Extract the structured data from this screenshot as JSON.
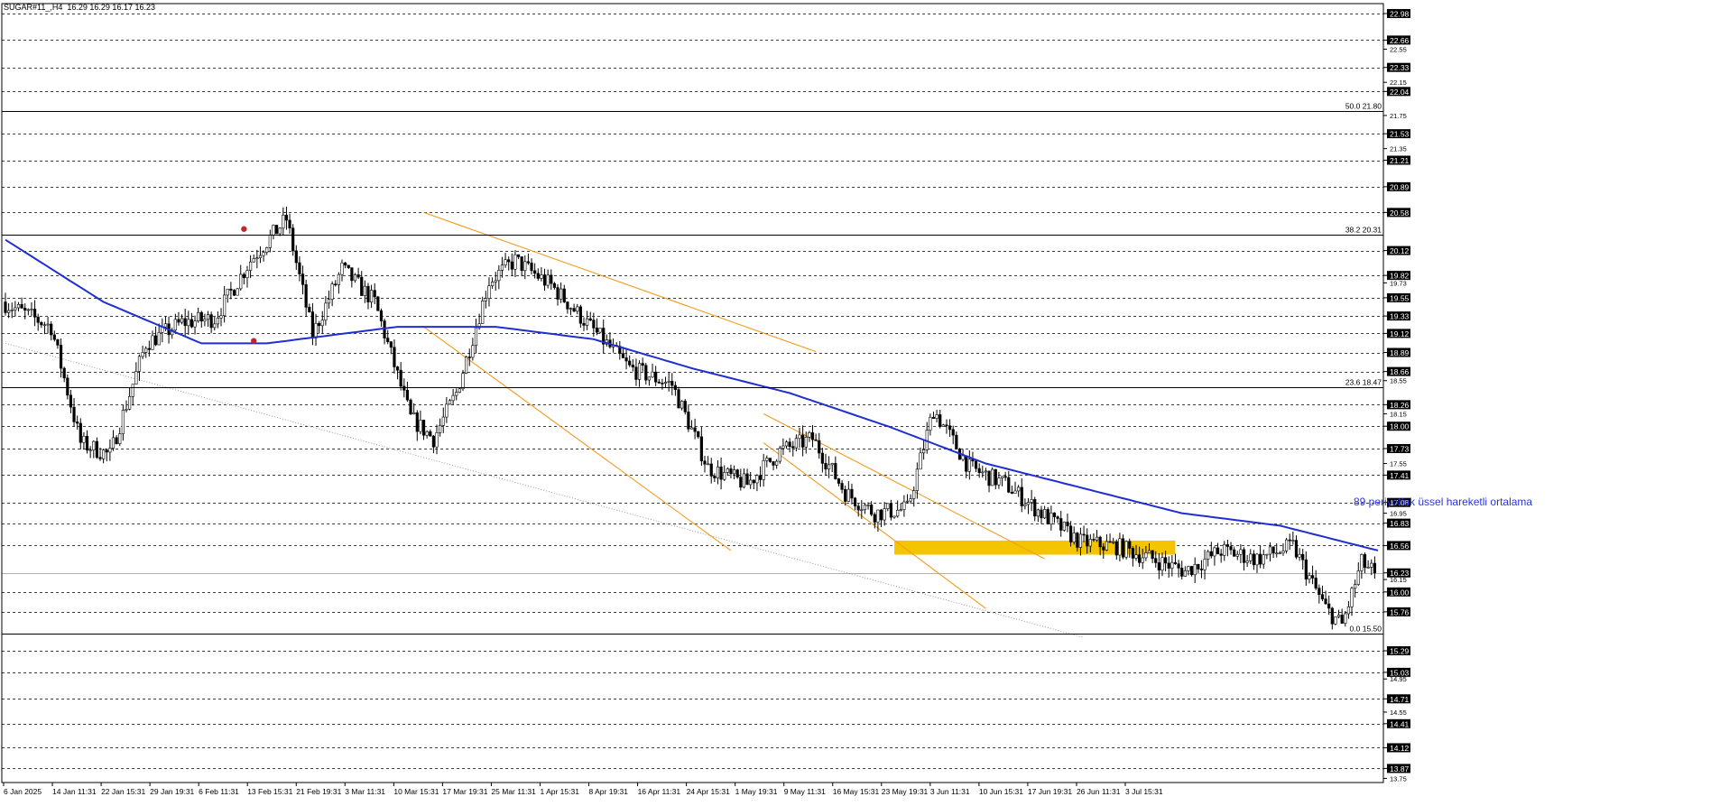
{
  "header": {
    "symbol": "SUGAR#11_,H4",
    "ohlc": "16.29 16.29 16.17 16.23"
  },
  "colors": {
    "background": "#ffffff",
    "grid": "#000000",
    "candle_up_fill": "#ffffff",
    "candle_down_fill": "#000000",
    "ema": "#1f2fd0",
    "channel": "#f59a1e",
    "zone": "#f5c400",
    "annotation": "#2b35d8",
    "marker": "#c0262d",
    "trend_dotted": "#9a9a9a"
  },
  "chart_data": {
    "type": "candlestick",
    "y_axis_price_labels": [
      "22.98",
      "22.66",
      "22.55",
      "22.33",
      "22.15",
      "22.04",
      "21.75",
      "21.53",
      "21.35",
      "21.21",
      "20.89",
      "20.58",
      "20.12",
      "19.82",
      "19.73",
      "19.55",
      "19.33",
      "19.12",
      "18.89",
      "18.66",
      "18.55",
      "18.26",
      "18.15",
      "18.00",
      "17.73",
      "17.55",
      "17.41",
      "17.08",
      "16.95",
      "16.83",
      "16.56",
      "16.23",
      "16.15",
      "16.00",
      "15.76",
      "15.29",
      "15.03",
      "14.95",
      "14.71",
      "14.55",
      "14.41",
      "14.12",
      "13.87",
      "13.75"
    ],
    "highlighted_price_labels": [
      "22.98",
      "22.66",
      "22.33",
      "22.04",
      "21.53",
      "21.21",
      "20.89",
      "20.58",
      "20.12",
      "19.82",
      "19.55",
      "19.33",
      "19.12",
      "18.89",
      "18.66",
      "18.26",
      "18.00",
      "17.73",
      "17.41",
      "17.08",
      "16.83",
      "16.56",
      "16.23",
      "16.00",
      "15.76",
      "15.29",
      "15.03",
      "14.71",
      "14.41",
      "14.12",
      "13.87"
    ],
    "current_price": 16.23,
    "y_range": [
      13.7,
      23.1
    ],
    "x_axis_labels": [
      "6 Jan 2025",
      "14 Jan 11:31",
      "22 Jan 15:31",
      "29 Jan 19:31",
      "6 Feb 11:31",
      "13 Feb 15:31",
      "21 Feb 19:31",
      "3 Mar 11:31",
      "10 Mar 15:31",
      "17 Mar 19:31",
      "25 Mar 11:31",
      "1 Apr 15:31",
      "8 Apr 19:31",
      "16 Apr 11:31",
      "24 Apr 15:31",
      "1 May 19:31",
      "9 May 11:31",
      "16 May 15:31",
      "23 May 19:31",
      "3 Jun 11:31",
      "10 Jun 15:31",
      "17 Jun 19:31",
      "26 Jun 11:31",
      "3 Jul 15:31"
    ],
    "fibonacci_levels": [
      {
        "label": "50.0 21.80",
        "price": 21.8
      },
      {
        "label": "38.2 20.31",
        "price": 20.31
      },
      {
        "label": "23.6 18.47",
        "price": 18.47
      },
      {
        "label": "0.0 15.50",
        "price": 15.5
      }
    ],
    "price_path": [
      [
        0,
        19.5
      ],
      [
        15,
        19.2
      ],
      [
        24,
        17.8
      ],
      [
        33,
        17.65
      ],
      [
        44,
        19.0
      ],
      [
        55,
        19.25
      ],
      [
        65,
        19.3
      ],
      [
        76,
        20.0
      ],
      [
        87,
        20.5
      ],
      [
        95,
        19.1
      ],
      [
        104,
        19.9
      ],
      [
        114,
        19.5
      ],
      [
        125,
        18.1
      ],
      [
        132,
        17.85
      ],
      [
        139,
        18.4
      ],
      [
        149,
        19.75
      ],
      [
        157,
        20.0
      ],
      [
        168,
        19.7
      ],
      [
        180,
        19.2
      ],
      [
        192,
        18.7
      ],
      [
        205,
        18.5
      ],
      [
        216,
        17.5
      ],
      [
        228,
        17.3
      ],
      [
        238,
        17.7
      ],
      [
        248,
        17.85
      ],
      [
        258,
        17.2
      ],
      [
        267,
        16.95
      ],
      [
        277,
        17.0
      ],
      [
        285,
        18.2
      ],
      [
        296,
        17.5
      ],
      [
        307,
        17.3
      ],
      [
        318,
        16.95
      ],
      [
        330,
        16.6
      ],
      [
        341,
        16.55
      ],
      [
        352,
        16.4
      ],
      [
        362,
        16.25
      ],
      [
        373,
        16.5
      ],
      [
        384,
        16.4
      ],
      [
        395,
        16.55
      ],
      [
        405,
        15.8
      ],
      [
        410,
        15.6
      ],
      [
        416,
        16.35
      ],
      [
        420,
        16.23
      ]
    ],
    "ema89_path": [
      [
        0,
        20.25
      ],
      [
        30,
        19.5
      ],
      [
        60,
        19.0
      ],
      [
        80,
        19.0
      ],
      [
        100,
        19.1
      ],
      [
        120,
        19.2
      ],
      [
        150,
        19.2
      ],
      [
        180,
        19.05
      ],
      [
        210,
        18.7
      ],
      [
        240,
        18.4
      ],
      [
        270,
        18.0
      ],
      [
        300,
        17.55
      ],
      [
        330,
        17.25
      ],
      [
        360,
        16.95
      ],
      [
        390,
        16.8
      ],
      [
        405,
        16.65
      ],
      [
        420,
        16.5
      ]
    ],
    "candle_count": 420,
    "markers": [
      {
        "bar": 73,
        "price": 20.38
      },
      {
        "bar": 76,
        "price": 19.03
      }
    ],
    "descending_channels": [
      {
        "upper": [
          [
            128,
            20.58
          ],
          [
            248,
            18.9
          ]
        ],
        "lower": [
          [
            128,
            19.2
          ],
          [
            222,
            16.5
          ]
        ]
      },
      {
        "upper": [
          [
            232,
            18.15
          ],
          [
            318,
            16.4
          ]
        ],
        "lower": [
          [
            232,
            17.8
          ],
          [
            300,
            15.8
          ]
        ]
      }
    ],
    "dotted_trendline": [
      [
        0,
        19.0
      ],
      [
        330,
        15.45
      ]
    ],
    "resistance_zone": {
      "bar_start": 272,
      "bar_end": 358,
      "price_low": 16.45,
      "price_high": 16.62
    },
    "annotation": "89 periyotluk üssel hareketli ortalama"
  }
}
